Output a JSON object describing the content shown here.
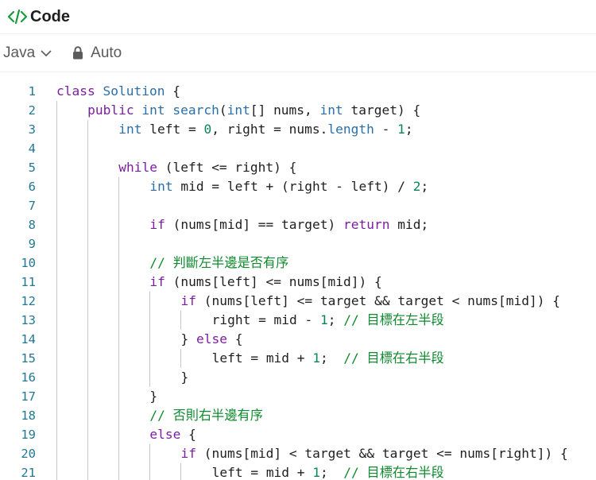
{
  "header": {
    "title": "Code",
    "icon": "code-icon"
  },
  "toolbar": {
    "language": "Java",
    "mode": "Auto"
  },
  "editor": {
    "lines": [
      {
        "n": "1",
        "indent": 0,
        "code": "class Solution {"
      },
      {
        "n": "2",
        "indent": 1,
        "code": "public int search(int[] nums, int target) {"
      },
      {
        "n": "3",
        "indent": 2,
        "code": "int left = 0, right = nums.length - 1;"
      },
      {
        "n": "4",
        "indent": 0,
        "code": ""
      },
      {
        "n": "5",
        "indent": 2,
        "code": "while (left <= right) {"
      },
      {
        "n": "6",
        "indent": 3,
        "code": "int mid = left + (right - left) / 2;"
      },
      {
        "n": "7",
        "indent": 0,
        "code": ""
      },
      {
        "n": "8",
        "indent": 3,
        "code": "if (nums[mid] == target) return mid;"
      },
      {
        "n": "9",
        "indent": 0,
        "code": ""
      },
      {
        "n": "10",
        "indent": 3,
        "code": "// 判斷左半邊是否有序"
      },
      {
        "n": "11",
        "indent": 3,
        "code": "if (nums[left] <= nums[mid]) {"
      },
      {
        "n": "12",
        "indent": 4,
        "code": "if (nums[left] <= target && target < nums[mid]) {"
      },
      {
        "n": "13",
        "indent": 5,
        "code": "right = mid - 1; // 目標在左半段"
      },
      {
        "n": "14",
        "indent": 4,
        "code": "} else {"
      },
      {
        "n": "15",
        "indent": 5,
        "code": "left = mid + 1;  // 目標在右半段"
      },
      {
        "n": "16",
        "indent": 4,
        "code": "}"
      },
      {
        "n": "17",
        "indent": 3,
        "code": "}"
      },
      {
        "n": "18",
        "indent": 3,
        "code": "// 否則右半邊有序"
      },
      {
        "n": "19",
        "indent": 3,
        "code": "else {"
      },
      {
        "n": "20",
        "indent": 4,
        "code": "if (nums[mid] < target && target <= nums[right]) {"
      },
      {
        "n": "21",
        "indent": 5,
        "code": "left = mid + 1;  // 目標在右半段"
      }
    ]
  }
}
